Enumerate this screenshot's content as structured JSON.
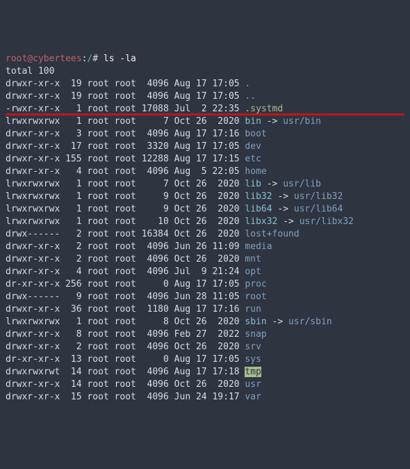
{
  "prompt_user": "root@cybertees",
  "prompt_path": "/",
  "prompt_sep1": ":",
  "prompt_sep2": "# ",
  "cmd": "ls -la",
  "total_label": "total 100",
  "arrow": " -> ",
  "rows": [
    {
      "perm": "drwxr-xr-x",
      "n": " 19",
      "o": "root",
      "g": "root",
      "sz": " 4096",
      "dt": "Aug 17 17:05",
      "name": ".",
      "cls": "c-blue",
      "link": ""
    },
    {
      "perm": "drwxr-xr-x",
      "n": " 19",
      "o": "root",
      "g": "root",
      "sz": " 4096",
      "dt": "Aug 17 17:05",
      "name": "..",
      "cls": "c-blue",
      "link": ""
    },
    {
      "perm": "-rwxr-xr-x",
      "n": "  1",
      "o": "root",
      "g": "root",
      "sz": "17088",
      "dt": "Jul  2 22:35",
      "name": ".systmd",
      "cls": "c-green",
      "link": "",
      "hl": true
    },
    {
      "perm": "lrwxrwxrwx",
      "n": "  1",
      "o": "root",
      "g": "root",
      "sz": "    7",
      "dt": "Oct 26  2020",
      "name": "bin",
      "cls": "c-cyan",
      "link": "usr/bin",
      "lcls": "c-blue"
    },
    {
      "perm": "drwxr-xr-x",
      "n": "  3",
      "o": "root",
      "g": "root",
      "sz": " 4096",
      "dt": "Aug 17 17:16",
      "name": "boot",
      "cls": "c-blue",
      "link": ""
    },
    {
      "perm": "drwxr-xr-x",
      "n": " 17",
      "o": "root",
      "g": "root",
      "sz": " 3320",
      "dt": "Aug 17 17:05",
      "name": "dev",
      "cls": "c-blue",
      "link": ""
    },
    {
      "perm": "drwxr-xr-x",
      "n": "155",
      "o": "root",
      "g": "root",
      "sz": "12288",
      "dt": "Aug 17 17:15",
      "name": "etc",
      "cls": "c-blue",
      "link": ""
    },
    {
      "perm": "drwxr-xr-x",
      "n": "  4",
      "o": "root",
      "g": "root",
      "sz": " 4096",
      "dt": "Aug  5 22:05",
      "name": "home",
      "cls": "c-blue",
      "link": ""
    },
    {
      "perm": "lrwxrwxrwx",
      "n": "  1",
      "o": "root",
      "g": "root",
      "sz": "    7",
      "dt": "Oct 26  2020",
      "name": "lib",
      "cls": "c-cyan",
      "link": "usr/lib",
      "lcls": "c-blue"
    },
    {
      "perm": "lrwxrwxrwx",
      "n": "  1",
      "o": "root",
      "g": "root",
      "sz": "    9",
      "dt": "Oct 26  2020",
      "name": "lib32",
      "cls": "c-cyan",
      "link": "usr/lib32",
      "lcls": "c-blue"
    },
    {
      "perm": "lrwxrwxrwx",
      "n": "  1",
      "o": "root",
      "g": "root",
      "sz": "    9",
      "dt": "Oct 26  2020",
      "name": "lib64",
      "cls": "c-cyan",
      "link": "usr/lib64",
      "lcls": "c-blue"
    },
    {
      "perm": "lrwxrwxrwx",
      "n": "  1",
      "o": "root",
      "g": "root",
      "sz": "   10",
      "dt": "Oct 26  2020",
      "name": "libx32",
      "cls": "c-cyan",
      "link": "usr/libx32",
      "lcls": "c-blue"
    },
    {
      "perm": "drwx------",
      "n": "  2",
      "o": "root",
      "g": "root",
      "sz": "16384",
      "dt": "Oct 26  2020",
      "name": "lost+found",
      "cls": "c-blue",
      "link": ""
    },
    {
      "perm": "drwxr-xr-x",
      "n": "  2",
      "o": "root",
      "g": "root",
      "sz": " 4096",
      "dt": "Jun 26 11:09",
      "name": "media",
      "cls": "c-blue",
      "link": ""
    },
    {
      "perm": "drwxr-xr-x",
      "n": "  2",
      "o": "root",
      "g": "root",
      "sz": " 4096",
      "dt": "Oct 26  2020",
      "name": "mnt",
      "cls": "c-blue",
      "link": ""
    },
    {
      "perm": "drwxr-xr-x",
      "n": "  4",
      "o": "root",
      "g": "root",
      "sz": " 4096",
      "dt": "Jul  9 21:24",
      "name": "opt",
      "cls": "c-blue",
      "link": ""
    },
    {
      "perm": "dr-xr-xr-x",
      "n": "256",
      "o": "root",
      "g": "root",
      "sz": "    0",
      "dt": "Aug 17 17:05",
      "name": "proc",
      "cls": "c-blue",
      "link": ""
    },
    {
      "perm": "drwx------",
      "n": "  9",
      "o": "root",
      "g": "root",
      "sz": " 4096",
      "dt": "Jun 28 11:05",
      "name": "root",
      "cls": "c-blue",
      "link": ""
    },
    {
      "perm": "drwxr-xr-x",
      "n": " 36",
      "o": "root",
      "g": "root",
      "sz": " 1180",
      "dt": "Aug 17 17:16",
      "name": "run",
      "cls": "c-blue",
      "link": ""
    },
    {
      "perm": "lrwxrwxrwx",
      "n": "  1",
      "o": "root",
      "g": "root",
      "sz": "    8",
      "dt": "Oct 26  2020",
      "name": "sbin",
      "cls": "c-cyan",
      "link": "usr/sbin",
      "lcls": "c-blue"
    },
    {
      "perm": "drwxr-xr-x",
      "n": "  8",
      "o": "root",
      "g": "root",
      "sz": " 4096",
      "dt": "Feb 27  2022",
      "name": "snap",
      "cls": "c-blue",
      "link": ""
    },
    {
      "perm": "drwxr-xr-x",
      "n": "  2",
      "o": "root",
      "g": "root",
      "sz": " 4096",
      "dt": "Oct 26  2020",
      "name": "srv",
      "cls": "c-blue",
      "link": ""
    },
    {
      "perm": "dr-xr-xr-x",
      "n": " 13",
      "o": "root",
      "g": "root",
      "sz": "    0",
      "dt": "Aug 17 17:05",
      "name": "sys",
      "cls": "c-blue",
      "link": ""
    },
    {
      "perm": "drwxrwxrwt",
      "n": " 14",
      "o": "root",
      "g": "root",
      "sz": " 4096",
      "dt": "Aug 17 17:18",
      "name": "tmp",
      "cls": "tmp",
      "link": ""
    },
    {
      "perm": "drwxr-xr-x",
      "n": " 14",
      "o": "root",
      "g": "root",
      "sz": " 4096",
      "dt": "Oct 26  2020",
      "name": "usr",
      "cls": "c-blue",
      "link": ""
    },
    {
      "perm": "drwxr-xr-x",
      "n": " 15",
      "o": "root",
      "g": "root",
      "sz": " 4096",
      "dt": "Jun 24 19:17",
      "name": "var",
      "cls": "c-blue",
      "link": ""
    }
  ]
}
